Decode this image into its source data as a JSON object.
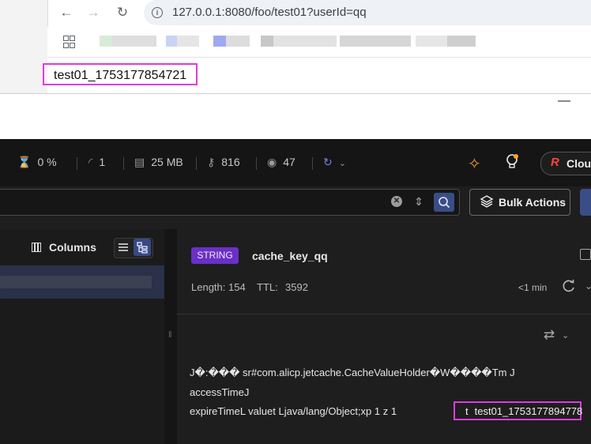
{
  "browser": {
    "url": "127.0.0.1:8080/foo/test01?userId=qq",
    "page_text": "test01_1753177854721"
  },
  "redis": {
    "stats": {
      "cpu": "0 %",
      "ops": "1",
      "memory": "25 MB",
      "keys": "816",
      "clients": "47"
    },
    "cloud_label": "Clou",
    "bulk_actions_label": "Bulk Actions",
    "columns_label": "Columns",
    "key": {
      "type": "STRING",
      "name": "cache_key_qq",
      "length": "Length: 154",
      "ttl_label": "TTL:",
      "ttl_value": "3592",
      "last_refresh": "<1 min"
    },
    "value": {
      "line1": "J�:���  sr#com.alicp.jetcache.CacheValueHolder�W����Tm   J",
      "line2": "accessTimeJ",
      "line3": "expireTimeL  valuet  Ljava/lang/Object;xp    1    z    1",
      "line3_tail": "t",
      "highlight": "test01_1753177894778"
    }
  }
}
